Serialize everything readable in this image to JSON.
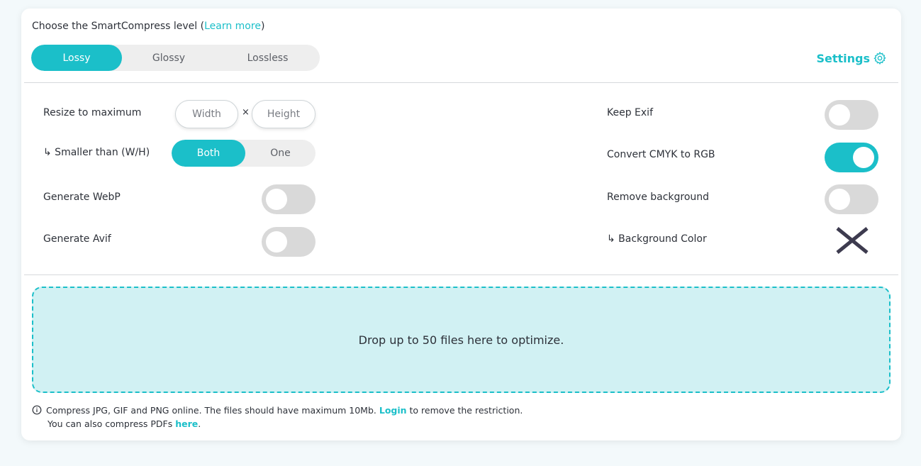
{
  "level": {
    "title_prefix": "Choose the SmartCompress level (",
    "learn_more": "Learn more",
    "title_suffix": ")",
    "options": [
      "Lossy",
      "Glossy",
      "Lossless"
    ],
    "selected": "Lossy"
  },
  "settings": {
    "label": "Settings",
    "icon": "gear-icon"
  },
  "options": {
    "resize_label": "Resize to maximum",
    "width_placeholder": "Width",
    "times": "×",
    "height_placeholder": "Height",
    "smaller_label": "↳ Smaller than (W/H)",
    "smaller_options": [
      "Both",
      "One"
    ],
    "smaller_selected": "Both",
    "webp_label": "Generate WebP",
    "webp_on": false,
    "avif_label": "Generate Avif",
    "avif_on": false,
    "exif_label": "Keep Exif",
    "exif_on": false,
    "cmyk_label": "Convert CMYK to RGB",
    "cmyk_on": true,
    "removebg_label": "Remove background",
    "removebg_on": false,
    "bgcolor_label": "↳ Background Color",
    "bgcolor_icon": "x-icon"
  },
  "dropzone": {
    "text": "Drop up to 50 files here to optimize."
  },
  "info": {
    "line1_prefix": "Compress JPG, GIF and PNG online. The files should have maximum 10Mb. ",
    "login": "Login",
    "line1_suffix": " to remove the restriction.",
    "line2_prefix": "You can also compress PDFs ",
    "here": "here",
    "line2_suffix": "."
  },
  "colors": {
    "accent": "#1bbfc9",
    "toggle_off": "#d9d9d9",
    "dropzone_bg": "#d1f1f3",
    "x_color": "#3d3b4f"
  }
}
